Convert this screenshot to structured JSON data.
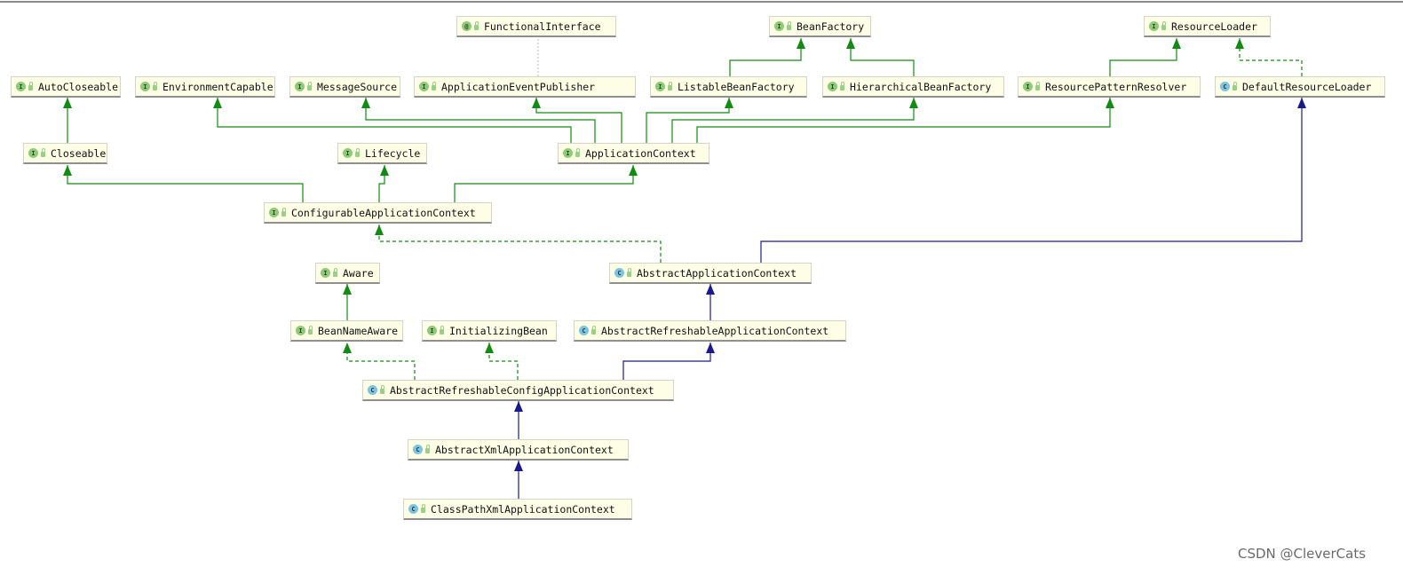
{
  "diagram": {
    "nodes": [
      {
        "id": "FunctionalInterface",
        "label": "FunctionalInterface",
        "kind": "annotation",
        "icon": "@"
      },
      {
        "id": "BeanFactory",
        "label": "BeanFactory",
        "kind": "interface",
        "icon": "I"
      },
      {
        "id": "ResourceLoader",
        "label": "ResourceLoader",
        "kind": "interface",
        "icon": "I"
      },
      {
        "id": "AutoCloseable",
        "label": "AutoCloseable",
        "kind": "interface",
        "icon": "I"
      },
      {
        "id": "EnvironmentCapable",
        "label": "EnvironmentCapable",
        "kind": "interface",
        "icon": "I"
      },
      {
        "id": "MessageSource",
        "label": "MessageSource",
        "kind": "interface",
        "icon": "I"
      },
      {
        "id": "ApplicationEventPublisher",
        "label": "ApplicationEventPublisher",
        "kind": "interface",
        "icon": "I"
      },
      {
        "id": "ListableBeanFactory",
        "label": "ListableBeanFactory",
        "kind": "interface",
        "icon": "I"
      },
      {
        "id": "HierarchicalBeanFactory",
        "label": "HierarchicalBeanFactory",
        "kind": "interface",
        "icon": "I"
      },
      {
        "id": "ResourcePatternResolver",
        "label": "ResourcePatternResolver",
        "kind": "interface",
        "icon": "I"
      },
      {
        "id": "DefaultResourceLoader",
        "label": "DefaultResourceLoader",
        "kind": "class",
        "icon": "C"
      },
      {
        "id": "Closeable",
        "label": "Closeable",
        "kind": "interface",
        "icon": "I"
      },
      {
        "id": "Lifecycle",
        "label": "Lifecycle",
        "kind": "interface",
        "icon": "I"
      },
      {
        "id": "ApplicationContext",
        "label": "ApplicationContext",
        "kind": "interface",
        "icon": "I"
      },
      {
        "id": "ConfigurableApplicationContext",
        "label": "ConfigurableApplicationContext",
        "kind": "interface",
        "icon": "I"
      },
      {
        "id": "Aware",
        "label": "Aware",
        "kind": "interface",
        "icon": "I"
      },
      {
        "id": "AbstractApplicationContext",
        "label": "AbstractApplicationContext",
        "kind": "class",
        "icon": "C"
      },
      {
        "id": "BeanNameAware",
        "label": "BeanNameAware",
        "kind": "interface",
        "icon": "I"
      },
      {
        "id": "InitializingBean",
        "label": "InitializingBean",
        "kind": "interface",
        "icon": "I"
      },
      {
        "id": "AbstractRefreshableApplicationContext",
        "label": "AbstractRefreshableApplicationContext",
        "kind": "class",
        "icon": "C"
      },
      {
        "id": "AbstractRefreshableConfigApplicationContext",
        "label": "AbstractRefreshableConfigApplicationContext",
        "kind": "class",
        "icon": "C"
      },
      {
        "id": "AbstractXmlApplicationContext",
        "label": "AbstractXmlApplicationContext",
        "kind": "class",
        "icon": "C"
      },
      {
        "id": "ClassPathXmlApplicationContext",
        "label": "ClassPathXmlApplicationContext",
        "kind": "class",
        "icon": "C"
      }
    ],
    "edges": [
      {
        "from": "ApplicationEventPublisher",
        "to": "FunctionalInterface",
        "type": "annotation"
      },
      {
        "from": "ListableBeanFactory",
        "to": "BeanFactory",
        "type": "extends-interface"
      },
      {
        "from": "HierarchicalBeanFactory",
        "to": "BeanFactory",
        "type": "extends-interface"
      },
      {
        "from": "ResourcePatternResolver",
        "to": "ResourceLoader",
        "type": "extends-interface"
      },
      {
        "from": "DefaultResourceLoader",
        "to": "ResourceLoader",
        "type": "implements"
      },
      {
        "from": "Closeable",
        "to": "AutoCloseable",
        "type": "extends-interface"
      },
      {
        "from": "ApplicationContext",
        "to": "EnvironmentCapable",
        "type": "extends-interface"
      },
      {
        "from": "ApplicationContext",
        "to": "MessageSource",
        "type": "extends-interface"
      },
      {
        "from": "ApplicationContext",
        "to": "ApplicationEventPublisher",
        "type": "extends-interface"
      },
      {
        "from": "ApplicationContext",
        "to": "ListableBeanFactory",
        "type": "extends-interface"
      },
      {
        "from": "ApplicationContext",
        "to": "HierarchicalBeanFactory",
        "type": "extends-interface"
      },
      {
        "from": "ApplicationContext",
        "to": "ResourcePatternResolver",
        "type": "extends-interface"
      },
      {
        "from": "ConfigurableApplicationContext",
        "to": "Closeable",
        "type": "extends-interface"
      },
      {
        "from": "ConfigurableApplicationContext",
        "to": "Lifecycle",
        "type": "extends-interface"
      },
      {
        "from": "ConfigurableApplicationContext",
        "to": "ApplicationContext",
        "type": "extends-interface"
      },
      {
        "from": "AbstractApplicationContext",
        "to": "ConfigurableApplicationContext",
        "type": "implements"
      },
      {
        "from": "AbstractApplicationContext",
        "to": "DefaultResourceLoader",
        "type": "extends-class"
      },
      {
        "from": "BeanNameAware",
        "to": "Aware",
        "type": "extends-interface"
      },
      {
        "from": "AbstractRefreshableApplicationContext",
        "to": "AbstractApplicationContext",
        "type": "extends-class"
      },
      {
        "from": "AbstractRefreshableConfigApplicationContext",
        "to": "BeanNameAware",
        "type": "implements"
      },
      {
        "from": "AbstractRefreshableConfigApplicationContext",
        "to": "InitializingBean",
        "type": "implements"
      },
      {
        "from": "AbstractRefreshableConfigApplicationContext",
        "to": "AbstractRefreshableApplicationContext",
        "type": "extends-class"
      },
      {
        "from": "AbstractXmlApplicationContext",
        "to": "AbstractRefreshableConfigApplicationContext",
        "type": "extends-class"
      },
      {
        "from": "ClassPathXmlApplicationContext",
        "to": "AbstractXmlApplicationContext",
        "type": "extends-class"
      }
    ],
    "colors": {
      "interface_edge": "#138a13",
      "class_edge": "#1a1a8c",
      "annotation_edge": "#c8c8b8",
      "node_bg": "#fefee6"
    }
  },
  "watermark": "CSDN @CleverCats"
}
